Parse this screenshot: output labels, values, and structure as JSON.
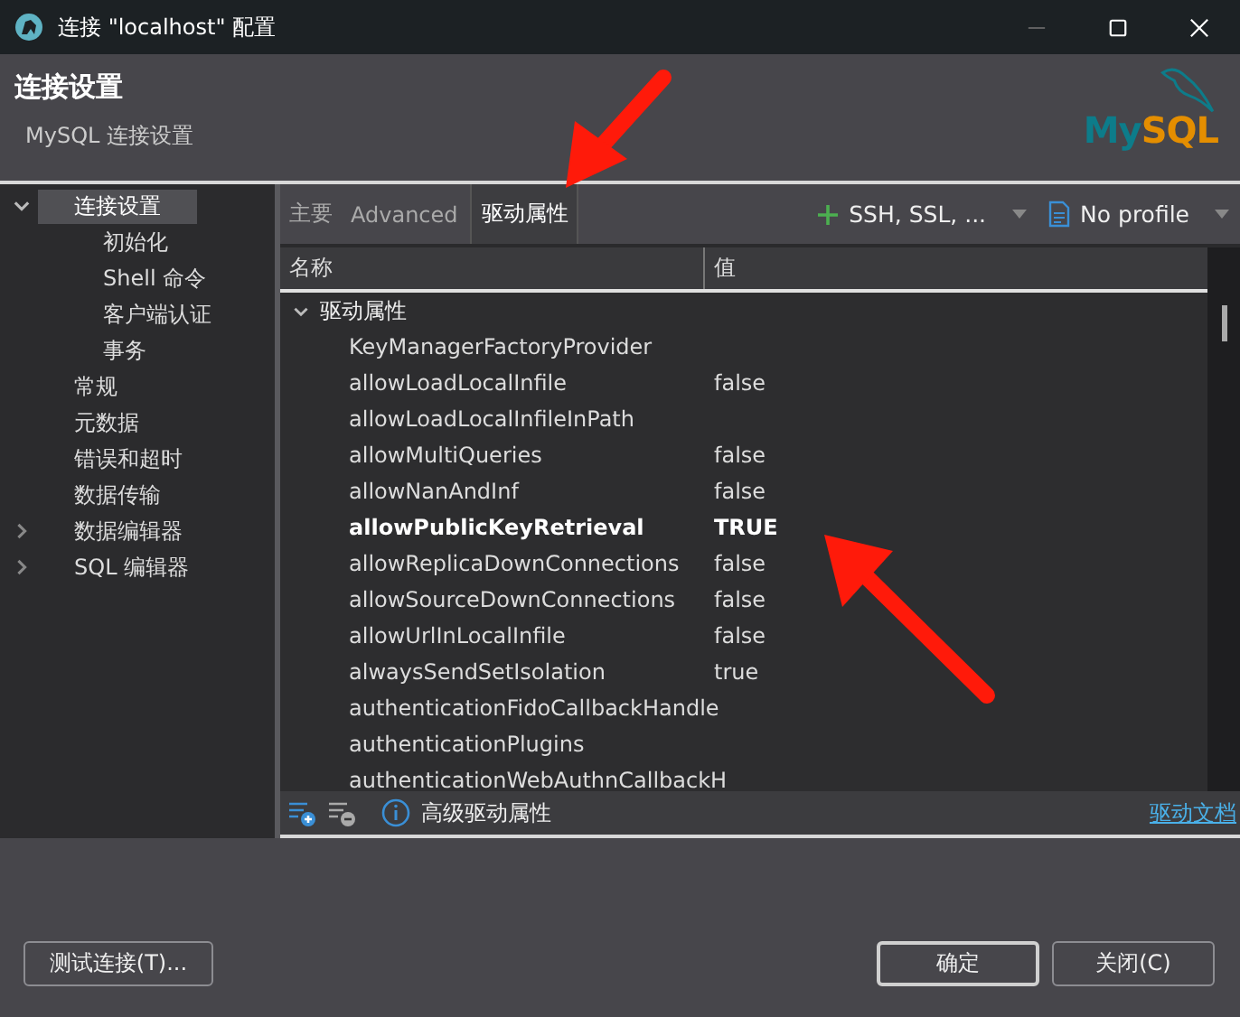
{
  "window": {
    "title": "连接 \"localhost\" 配置"
  },
  "header": {
    "title": "连接设置",
    "subtitle": "MySQL 连接设置",
    "logo": [
      "My",
      "SQL"
    ]
  },
  "tree": [
    {
      "label": "连接设置",
      "selected": true,
      "expanded": true,
      "children": [
        {
          "label": "初始化",
          "selected": false
        },
        {
          "label": "Shell 命令",
          "selected": false
        },
        {
          "label": "客户端认证",
          "selected": false
        },
        {
          "label": "事务",
          "selected": false
        }
      ]
    },
    {
      "label": "常规",
      "selected": false
    },
    {
      "label": "元数据",
      "selected": false
    },
    {
      "label": "错误和超时",
      "selected": false
    },
    {
      "label": "数据传输",
      "selected": false
    },
    {
      "label": "数据编辑器",
      "selected": false,
      "expanded": false
    },
    {
      "label": "SQL 编辑器",
      "selected": false,
      "expanded": false
    }
  ],
  "tabs": [
    {
      "label": "主要",
      "selected": false
    },
    {
      "label": "Advanced",
      "selected": false
    },
    {
      "label": "驱动属性",
      "selected": true
    }
  ],
  "toolbar": {
    "network_button": "SSH, SSL, ...",
    "profile_button": "No profile"
  },
  "table": {
    "columns": [
      "名称",
      "值"
    ],
    "group": {
      "label": "驱动属性",
      "expanded": true,
      "rows": [
        {
          "name": "KeyManagerFactoryProvider",
          "modified": false
        },
        {
          "name": "allowLoadLocalInfile",
          "value": "false",
          "modified": false
        },
        {
          "name": "allowLoadLocalInfileInPath",
          "modified": false
        },
        {
          "name": "allowMultiQueries",
          "value": "false",
          "modified": false
        },
        {
          "name": "allowNanAndInf",
          "value": "false",
          "modified": false
        },
        {
          "name": "allowPublicKeyRetrieval",
          "value": "TRUE",
          "modified": true
        },
        {
          "name": "allowReplicaDownConnections",
          "value": "false",
          "modified": false
        },
        {
          "name": "allowSourceDownConnections",
          "value": "false",
          "modified": false
        },
        {
          "name": "allowUrlInLocalInfile",
          "value": "false",
          "modified": false
        },
        {
          "name": "alwaysSendSetIsolation",
          "value": "true",
          "modified": false
        },
        {
          "name": "authenticationFidoCallbackHandle",
          "modified": false
        },
        {
          "name": "authenticationPlugins",
          "modified": false
        },
        {
          "name": "authenticationWebAuthnCallbackH",
          "modified": false
        }
      ]
    }
  },
  "footer": {
    "info": "高级驱动属性",
    "link": "驱动文档"
  },
  "buttons": {
    "test": "测试连接(T)...",
    "ok": "确定",
    "close": "关闭(C)"
  }
}
